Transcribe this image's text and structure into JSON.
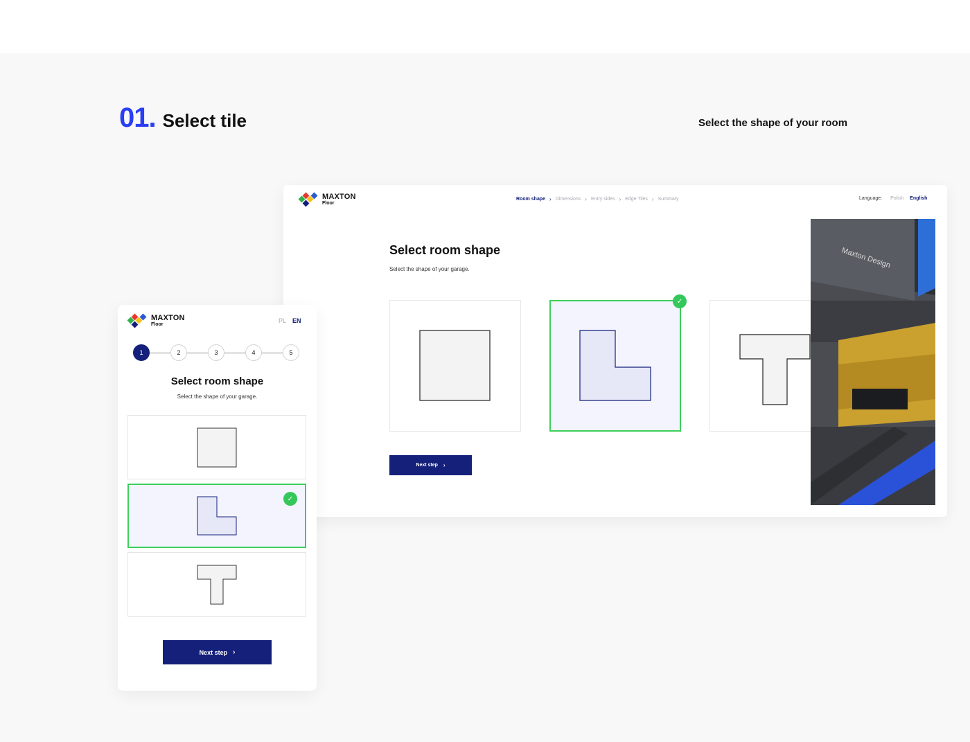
{
  "section": {
    "number": "01.",
    "title": "Select tile",
    "subtitle": "Select the shape of your room"
  },
  "brand": {
    "name": "MAXTON",
    "sub": "Floor",
    "colors": [
      "#e63a2e",
      "#f6c21b",
      "#2eb34a",
      "#2a5ad6",
      "#14207a"
    ]
  },
  "desktop": {
    "steps": [
      {
        "label": "Room shape",
        "active": true
      },
      {
        "label": "Dimensions",
        "active": false
      },
      {
        "label": "Entry sides",
        "active": false
      },
      {
        "label": "Edge Tiles",
        "active": false
      },
      {
        "label": "Summary",
        "active": false
      }
    ],
    "language": {
      "label": "Language:",
      "options": [
        {
          "label": "Polish",
          "active": false
        },
        {
          "label": "English",
          "active": true
        }
      ]
    },
    "title": "Select room shape",
    "description": "Select the shape of your garage.",
    "shapes": [
      {
        "name": "square",
        "selected": false
      },
      {
        "name": "l-shape",
        "selected": true
      },
      {
        "name": "t-shape",
        "selected": false
      }
    ],
    "next_label": "Next step",
    "photo_text": "Maxton Design"
  },
  "mobile": {
    "language": [
      {
        "label": "PL",
        "active": false
      },
      {
        "label": "EN",
        "active": true
      }
    ],
    "steps": [
      "1",
      "2",
      "3",
      "4",
      "5"
    ],
    "active_step": 0,
    "title": "Select room shape",
    "description": "Select the shape of your garage.",
    "next_label": "Next step"
  },
  "colors": {
    "accent": "#2a3ff5",
    "navy": "#14207a",
    "success": "#34c759",
    "selected_bg": "#f3f4fe"
  }
}
